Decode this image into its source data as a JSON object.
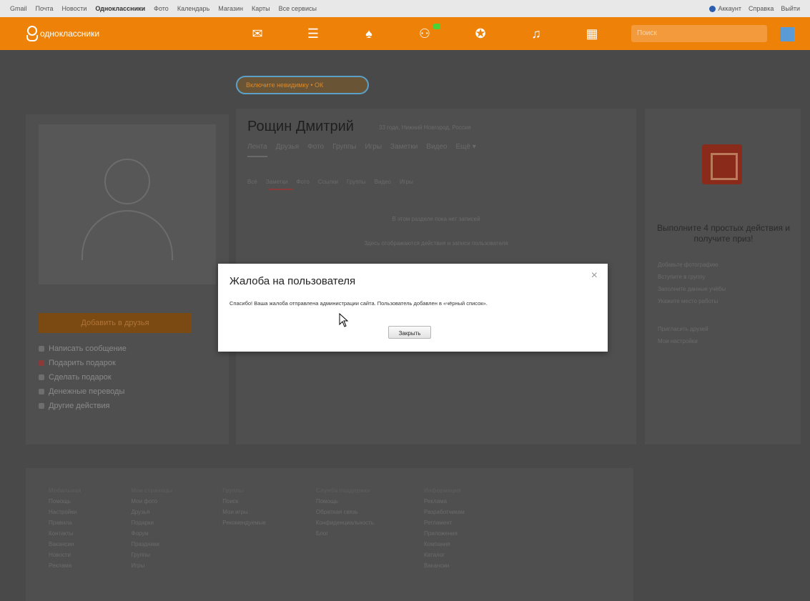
{
  "bookmarks": {
    "items": [
      "Gmail",
      "Почта",
      "Новости",
      "Одноклассники",
      "Фото",
      "Календарь",
      "Магазин",
      "Карты",
      "Все сервисы"
    ],
    "account": "Аккаунт",
    "right_items": [
      "Справка",
      "Выйти"
    ]
  },
  "topbar": {
    "logo_text": "одноклассники",
    "search_placeholder": "Поиск",
    "nav_icons": [
      "mail-icon",
      "chat-icon",
      "bell-icon",
      "guests-icon",
      "events-icon",
      "music-icon",
      "video-icon"
    ]
  },
  "promo": {
    "label": "Включите невидимку • ОК"
  },
  "profile": {
    "name": "Рощин Дмитрий",
    "subtitle": "33 года, Нижний Новгород, Россия",
    "tabs": [
      "Лента",
      "Друзья",
      "Фото",
      "Группы",
      "Игры",
      "Заметки",
      "Видео",
      "Ещё ▾"
    ],
    "subtabs": [
      "Всё",
      "Заметки",
      "Фото",
      "Ссылки",
      "Группы",
      "Видео",
      "Игры"
    ],
    "empty_line1": "В этом разделе пока нет записей",
    "empty_line2": "Здесь отображаются действия и записи пользователя"
  },
  "left": {
    "add_friend_label": "Добавить в друзья",
    "menu": [
      {
        "label": "Написать сообщение",
        "icon": "message-icon"
      },
      {
        "label": "Подарить подарок",
        "icon": "gift-icon"
      },
      {
        "label": "Сделать подарок",
        "icon": "present-icon"
      },
      {
        "label": "Денежные переводы",
        "icon": "money-icon"
      },
      {
        "label": "Другие действия",
        "icon": "more-icon"
      }
    ]
  },
  "right": {
    "title": "Выполните 4 простых действия и получите приз!",
    "tasks": [
      "Добавьте фотографию",
      "Вступите в группу",
      "Заполните данные учёбы",
      "Укажите место работы"
    ],
    "links": [
      "Пригласить друзей",
      "Мои настройки"
    ]
  },
  "footer": {
    "columns": [
      {
        "head": "Мобильная",
        "items": [
          "Помощь",
          "Настройки",
          "Правила",
          "Контакты",
          "Вакансии",
          "Новости",
          "Реклама"
        ]
      },
      {
        "head": "Мои страницы",
        "items": [
          "Мои фото",
          "Друзья",
          "Подарки",
          "Форум",
          "Праздники",
          "Группы",
          "Игры"
        ]
      },
      {
        "head": "Группы",
        "items": [
          "Поиск",
          "Мои игры",
          "Рекомендуемые"
        ]
      },
      {
        "head": "Служба поддержки",
        "items": [
          "Помощь",
          "Обратная связь",
          "Конфиденциальность",
          "Блог"
        ]
      },
      {
        "head": "Информация",
        "items": [
          "Реклама",
          "Разработчикам",
          "Регламент",
          "Приложения",
          "Компания",
          "Каталог",
          "Вакансии"
        ]
      }
    ]
  },
  "modal": {
    "title": "Жалоба на пользователя",
    "message": "Спасибо! Ваша жалоба отправлена администрации сайта. Пользователь добавлен в «чёрный список».",
    "close_button": "Закрыть",
    "close_icon": "×"
  }
}
